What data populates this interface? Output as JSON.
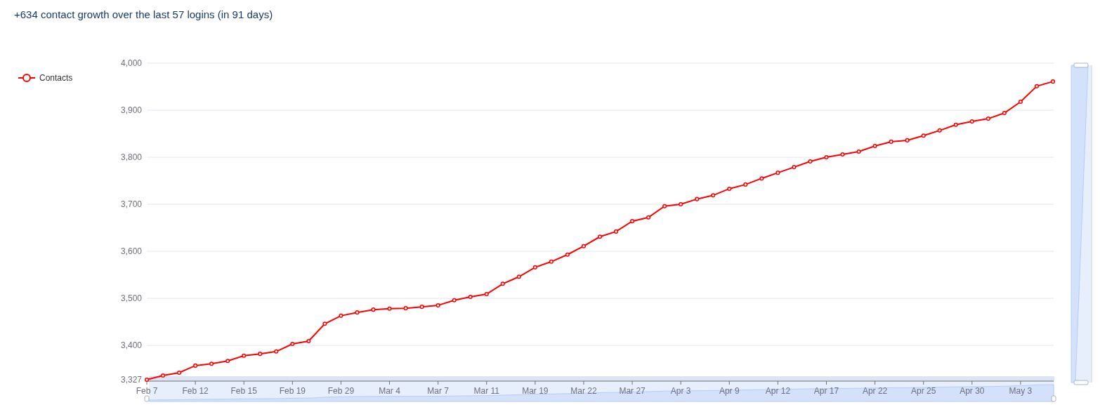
{
  "title": "+634 contact growth over the last 57 logins (in 91 days)",
  "chart": {
    "chart_data": {
      "type": "line",
      "grid": true,
      "categories": [
        "Feb 7",
        null,
        null,
        "Feb 12",
        null,
        null,
        "Feb 15",
        null,
        null,
        "Feb 19",
        null,
        null,
        "Feb 29",
        null,
        null,
        "Mar 4",
        null,
        null,
        "Mar 7",
        null,
        null,
        "Mar 11",
        null,
        null,
        "Mar 19",
        null,
        null,
        "Mar 22",
        null,
        null,
        "Mar 27",
        null,
        null,
        "Apr 3",
        null,
        null,
        "Apr 9",
        null,
        null,
        "Apr 12",
        null,
        null,
        "Apr 17",
        null,
        null,
        "Apr 22",
        null,
        null,
        "Apr 25",
        null,
        null,
        "Apr 30",
        null,
        null,
        "May 3",
        null,
        null
      ],
      "series": [
        {
          "name": "Contacts",
          "color": "#ff0000",
          "marker": "circle",
          "values": [
            3327,
            3336,
            3342,
            3357,
            3361,
            3367,
            3378,
            3382,
            3387,
            3403,
            3409,
            3446,
            3463,
            3470,
            3476,
            3478,
            3479,
            3482,
            3485,
            3496,
            3503,
            3509,
            3531,
            3546,
            3566,
            3578,
            3593,
            3611,
            3631,
            3642,
            3664,
            3672,
            3696,
            3700,
            3711,
            3719,
            3733,
            3742,
            3755,
            3767,
            3779,
            3791,
            3800,
            3806,
            3812,
            3824,
            3833,
            3836,
            3846,
            3857,
            3869,
            3876,
            3882,
            3894,
            3918,
            3951,
            3961
          ]
        }
      ],
      "ylim": [
        3327,
        4000
      ],
      "yticks": [
        {
          "value": 3327,
          "label": "3,327"
        },
        {
          "value": 3400,
          "label": "3,400"
        },
        {
          "value": 3500,
          "label": "3,500"
        },
        {
          "value": 3600,
          "label": "3,600"
        },
        {
          "value": 3700,
          "label": "3,700"
        },
        {
          "value": 3800,
          "label": "3,800"
        },
        {
          "value": 3900,
          "label": "3,900"
        },
        {
          "value": 4000,
          "label": "4,000"
        }
      ]
    }
  }
}
